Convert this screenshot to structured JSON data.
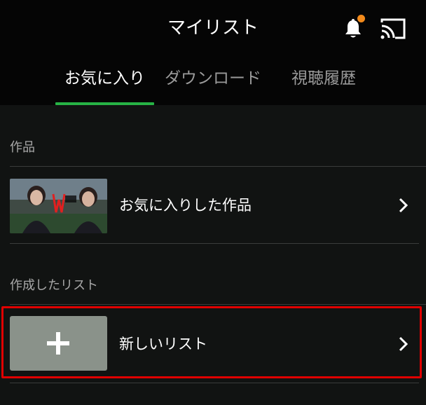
{
  "header": {
    "title": "マイリスト",
    "icons": {
      "notification": "bell-icon",
      "notification_badge_color": "#f28a1b",
      "cast": "cast-icon"
    }
  },
  "tabs": [
    {
      "label": "お気に入り",
      "active": true
    },
    {
      "label": "ダウンロード",
      "active": false
    },
    {
      "label": "視聴履歴",
      "active": false
    }
  ],
  "accent_color": "#27b345",
  "sections": {
    "works": {
      "label": "作品",
      "item": {
        "label": "お気に入りした作品",
        "thumbnail": "drama-poster-two-women",
        "icon": "chevron-right-icon"
      }
    },
    "lists": {
      "label": "作成したリスト",
      "item": {
        "label": "新しいリスト",
        "thumbnail_icon": "plus-icon",
        "icon": "chevron-right-icon",
        "highlight_color": "#e00000"
      }
    }
  }
}
